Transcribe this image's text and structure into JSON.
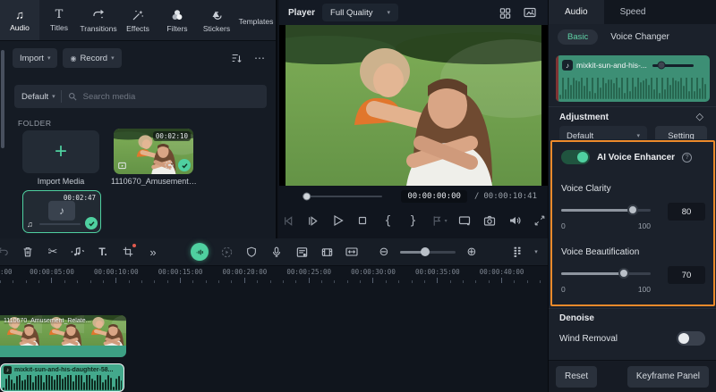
{
  "icons": {
    "chevron_down": "▾",
    "more_horizontal": "⋯",
    "more_tools": "»",
    "scissors": "✂",
    "zoom_in": "⊕",
    "zoom_out": "⊖",
    "brace_open": "{",
    "brace_close": "}",
    "music_note": "♪",
    "music_notes": "♫",
    "record_dot": "◉",
    "plus": "+",
    "text_tool": "T.",
    "diamond": "◇",
    "info": "?"
  },
  "nav": {
    "active": "Audio",
    "items": [
      {
        "label": "Audio"
      },
      {
        "label": "Titles"
      },
      {
        "label": "Transitions"
      },
      {
        "label": "Effects"
      },
      {
        "label": "Filters"
      },
      {
        "label": "Stickers"
      },
      {
        "label": "Templates"
      }
    ]
  },
  "media_panel": {
    "import_label": "Import",
    "record_label": "Record",
    "preset": "Default",
    "search_placeholder": "Search media",
    "folder_label": "FOLDER",
    "items": [
      {
        "label": "Import Media"
      },
      {
        "label": "1110670_Amusement_...",
        "duration": "00:02:10"
      },
      {
        "duration": "00:02:47"
      }
    ]
  },
  "player": {
    "label": "Player",
    "quality": "Full Quality",
    "current_time": "00:00:00:00",
    "separator": "/",
    "duration": "00:00:10:41"
  },
  "right_panel": {
    "tabs": [
      {
        "label": "Audio"
      },
      {
        "label": "Speed"
      }
    ],
    "active_tab": "Audio",
    "subtabs": [
      {
        "label": "Basic"
      },
      {
        "label": "Voice Changer"
      }
    ],
    "active_subtab": "Basic",
    "clip_name": "mixkit-sun-and-his-...",
    "adjustment": {
      "title": "Adjustment",
      "preset": "Default",
      "setting_label": "Setting"
    },
    "ai_voice_enhancer": {
      "label": "AI Voice Enhancer",
      "enabled": true,
      "sliders": [
        {
          "label": "Voice Clarity",
          "value": 80,
          "min": 0,
          "max": 100
        },
        {
          "label": "Voice Beautification",
          "value": 70,
          "min": 0,
          "max": 100
        }
      ]
    },
    "denoise_label": "Denoise",
    "wind_removal": {
      "label": "Wind Removal",
      "enabled": false
    },
    "footer": {
      "reset_label": "Reset",
      "keyframe_label": "Keyframe Panel"
    }
  },
  "timeline": {
    "ruler_start_fragment": ":00",
    "ruler_labels": [
      "00:00:05:00",
      "00:00:10:00",
      "00:00:15:00",
      "00:00:20:00",
      "00:00:25:00",
      "00:00:30:00",
      "00:00:35:00",
      "00:00:40:00"
    ],
    "video_clip": {
      "name": "1110670_Amusement_Relate..."
    },
    "audio_clip": {
      "name": "mixkit-sun-and-his-daughter-58..."
    }
  },
  "colors": {
    "accent_teal": "#4fd0a0",
    "highlight_orange": "#ec8a2b",
    "audio_clip_green": "#3d8f75",
    "panel_bg": "#1b212b"
  }
}
